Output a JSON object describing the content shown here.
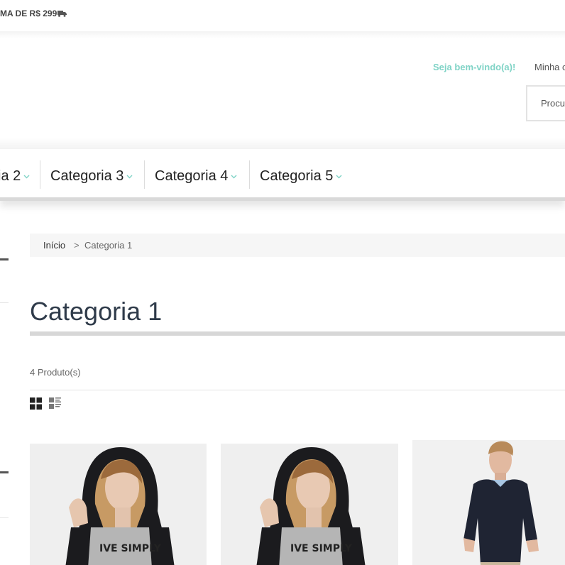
{
  "topbar": {
    "shipping_text": "MA DE R$ 299"
  },
  "header": {
    "welcome": "Seja bem-vindo(a)!",
    "account": "Minha c",
    "search_placeholder": "Procu"
  },
  "nav": {
    "items": [
      {
        "label": "ia 2"
      },
      {
        "label": "Categoria 3"
      },
      {
        "label": "Categoria 4"
      },
      {
        "label": "Categoria 5"
      }
    ]
  },
  "breadcrumb": {
    "home": "Início",
    "separator": ">",
    "current": "Categoria 1"
  },
  "category": {
    "title": "Categoria 1",
    "count": "4 Produto(s)"
  },
  "products": [
    {
      "image": "woman-hoodie-live-simply"
    },
    {
      "image": "woman-hoodie-live-simply"
    },
    {
      "image": "man-navy-sweater"
    }
  ],
  "colors": {
    "accent": "#7fd3c6",
    "title": "#2f3b4a",
    "nav_text": "#222222"
  }
}
